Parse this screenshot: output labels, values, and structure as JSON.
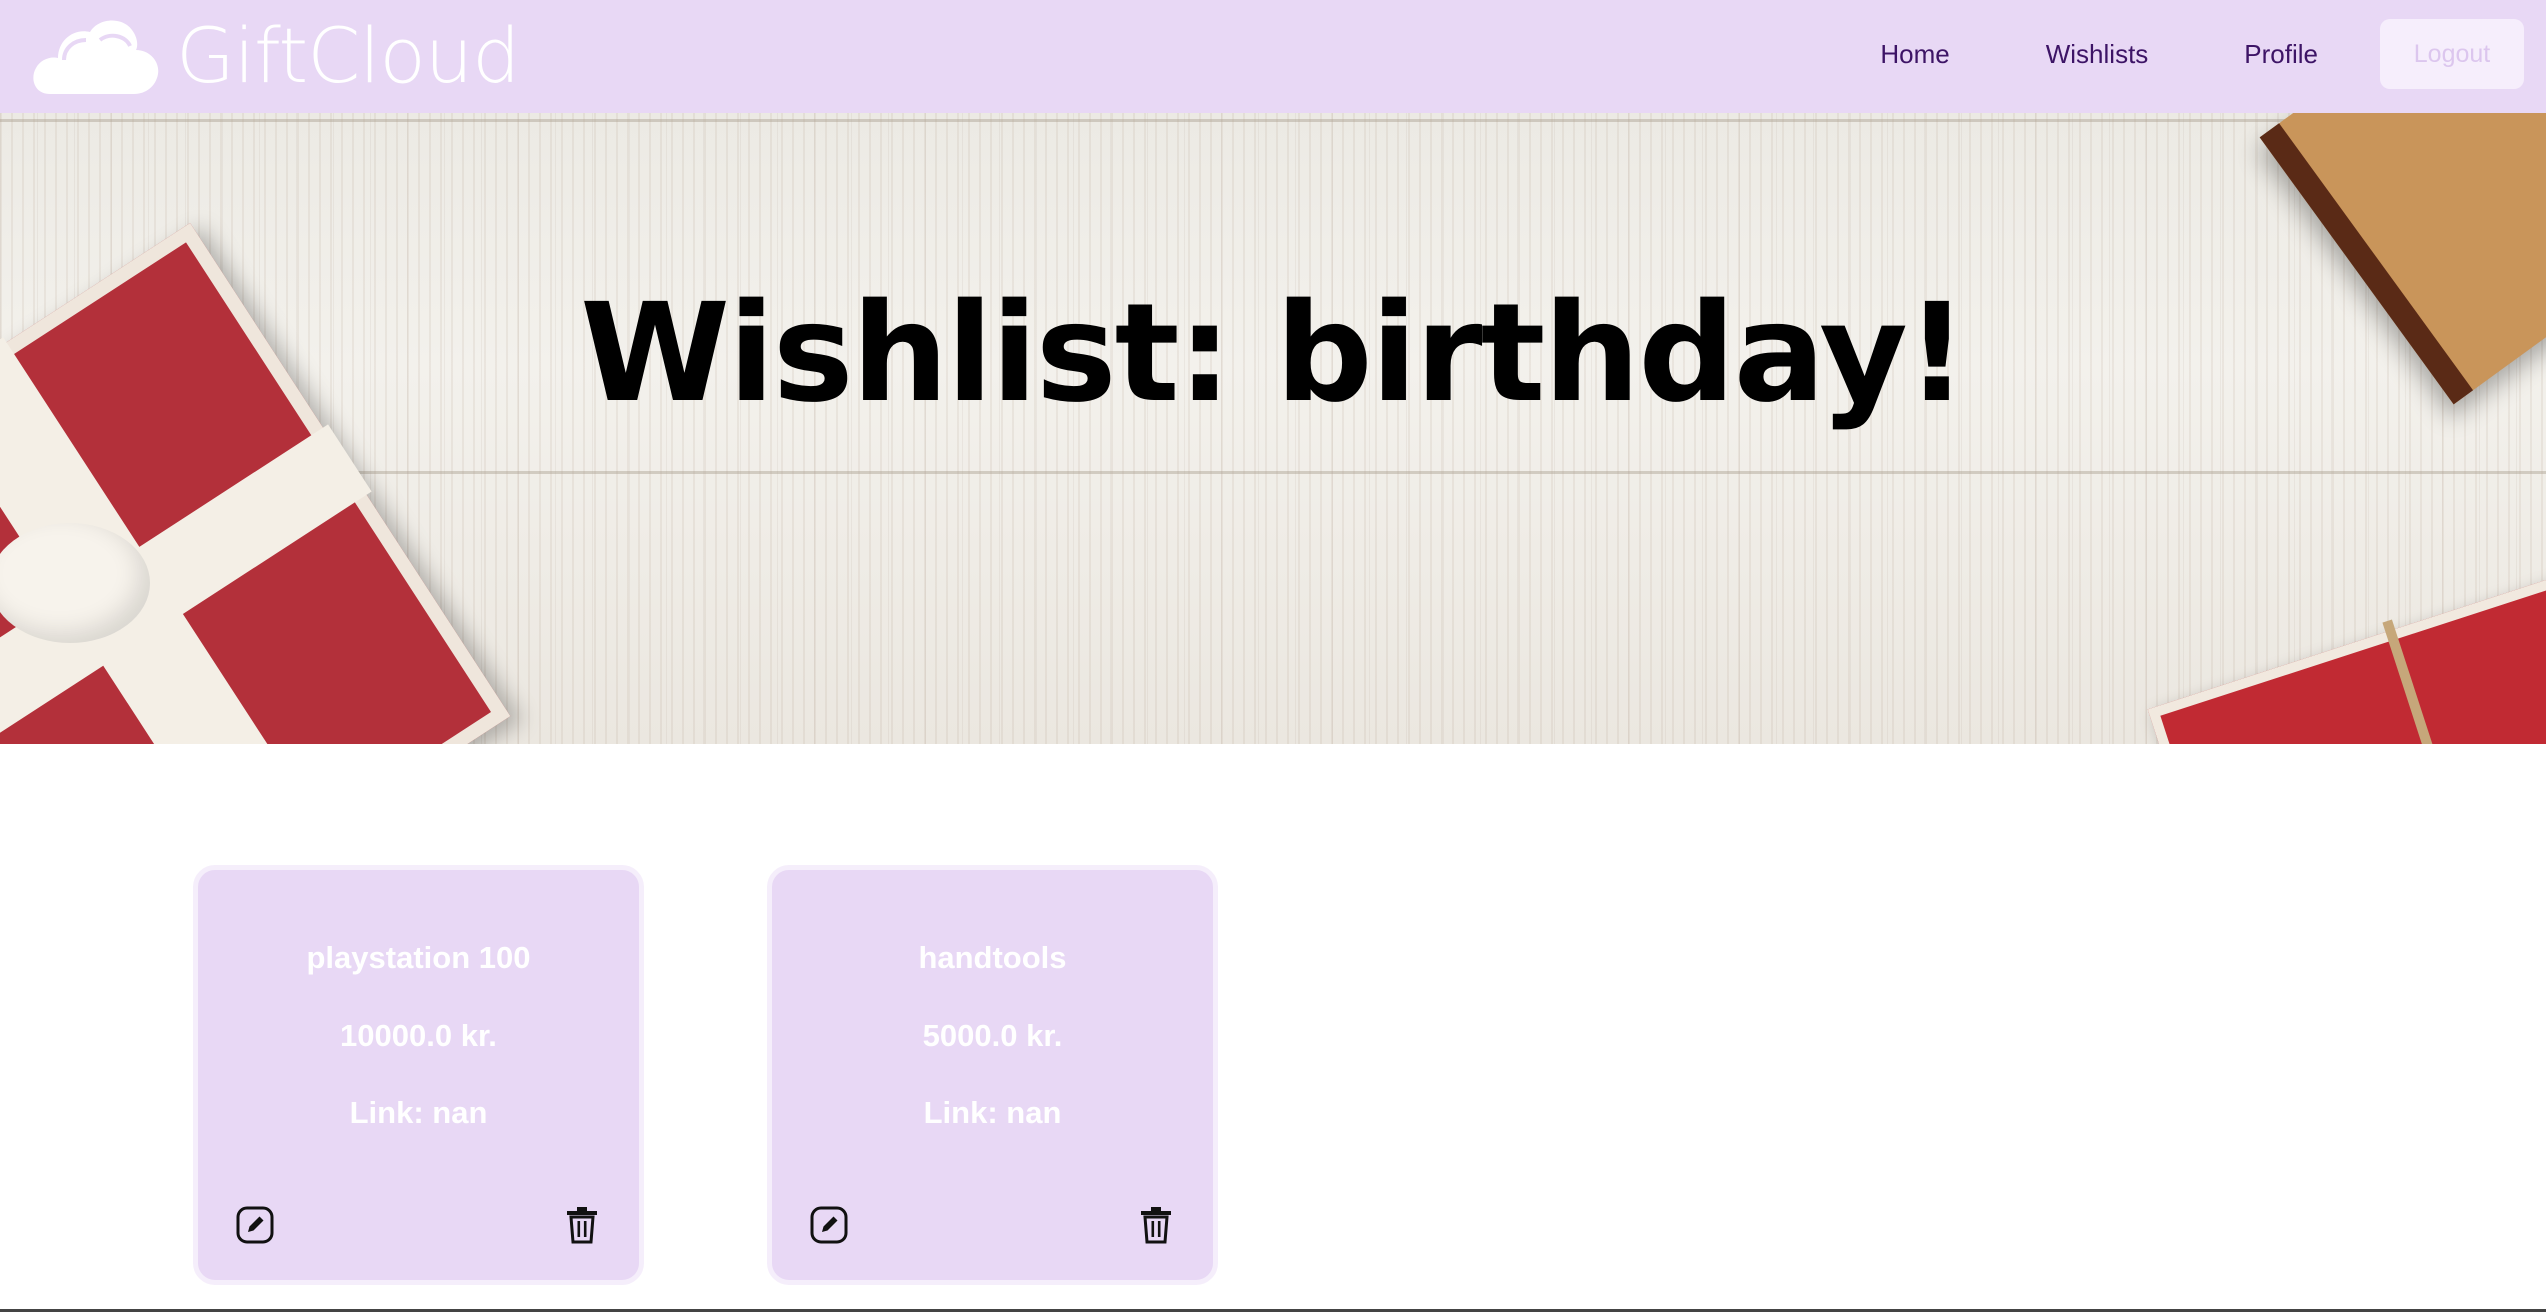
{
  "brand": {
    "name": "GiftCloud",
    "logo_icon": "cloud-icon",
    "navbar_color": "#e8d8f5"
  },
  "nav": {
    "items": [
      {
        "label": "Home"
      },
      {
        "label": "Wishlists"
      },
      {
        "label": "Profile"
      }
    ],
    "logout_label": "Logout"
  },
  "hero": {
    "title": "Wishlist: birthday!"
  },
  "wishes": [
    {
      "name": "playstation 100",
      "price": "10000.0 kr.",
      "link": "Link: nan",
      "edit_icon": "pencil-square-icon",
      "delete_icon": "trash-icon"
    },
    {
      "name": "handtools",
      "price": "5000.0 kr.",
      "link": "Link: nan",
      "edit_icon": "pencil-square-icon",
      "delete_icon": "trash-icon"
    }
  ],
  "colors": {
    "accent": "#e8d8f5",
    "nav_text": "#3d1466",
    "card_text": "#ffffff"
  }
}
